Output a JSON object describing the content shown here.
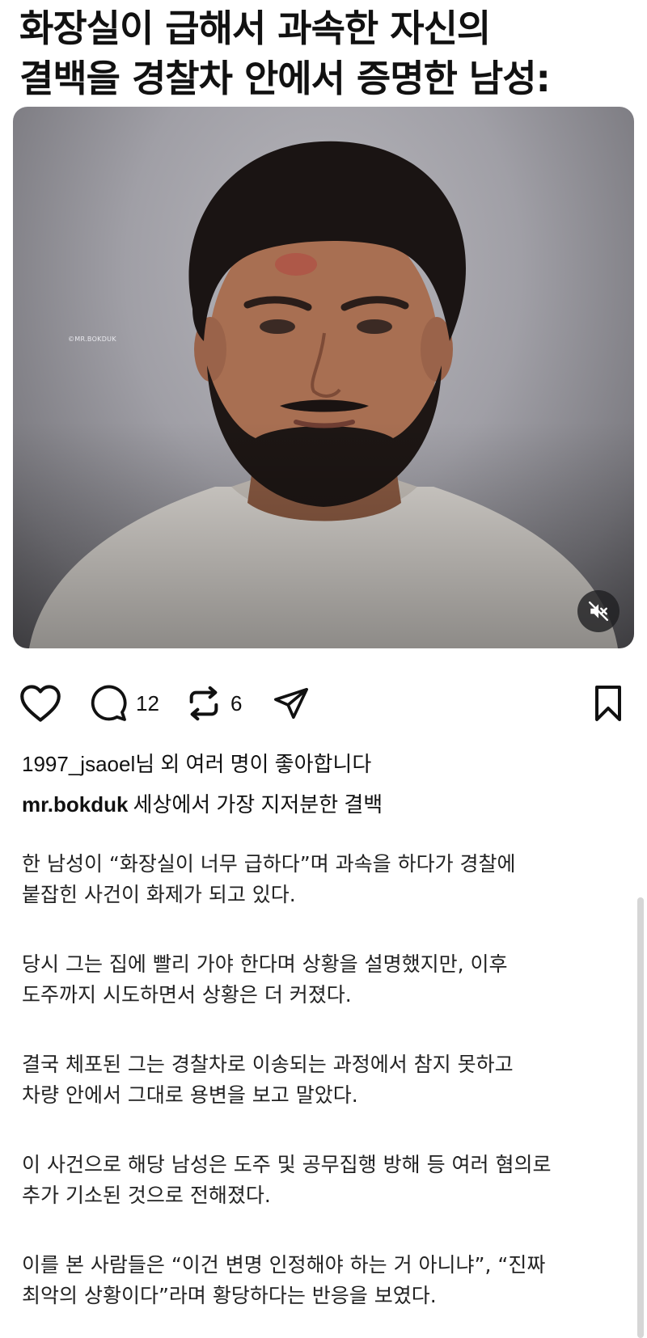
{
  "post": {
    "headline_line1": "화장실이 급해서 과속한 자신의",
    "headline_line2": "결백을 경찰차 안에서 증명한 남성:",
    "media": {
      "watermark": "©MR.BOKDUK",
      "mute_icon": "speaker-muted-icon"
    },
    "actions": {
      "like_icon": "heart-icon",
      "comment_icon": "comment-bubble-icon",
      "comment_count": "12",
      "repost_icon": "repost-icon",
      "repost_count": "6",
      "share_icon": "paper-plane-icon",
      "save_icon": "bookmark-icon"
    },
    "likes": {
      "user": "1997_jsaoel",
      "suffix": "님 외 여러 명이 좋아합니다"
    },
    "caption": {
      "user": "mr.bokduk",
      "text": "세상에서 가장 지저분한 결백"
    },
    "paragraphs": [
      {
        "line1": "한 남성이 “화장실이 너무 급하다”며 과속을 하다가 경찰에",
        "line2": "붙잡힌 사건이 화제가 되고 있다."
      },
      {
        "line1": "당시 그는 집에 빨리 가야 한다며 상황을 설명했지만, 이후",
        "line2": "도주까지 시도하면서 상황은 더 커졌다."
      },
      {
        "line1": "결국 체포된 그는 경찰차로 이송되는 과정에서 참지 못하고",
        "line2": "차량 안에서 그대로 용변을 보고 말았다."
      },
      {
        "line1": "이 사건으로 해당 남성은 도주 및 공무집행 방해 등 여러 혐의로",
        "line2": "추가 기소된 것으로 전해졌다."
      },
      {
        "line1": "이를 본 사람들은 “이건 변명 인정해야 하는 거 아니냐”, “진짜",
        "line2": "최악의 상황이다”라며 황당하다는 반응을 보였다."
      }
    ]
  }
}
